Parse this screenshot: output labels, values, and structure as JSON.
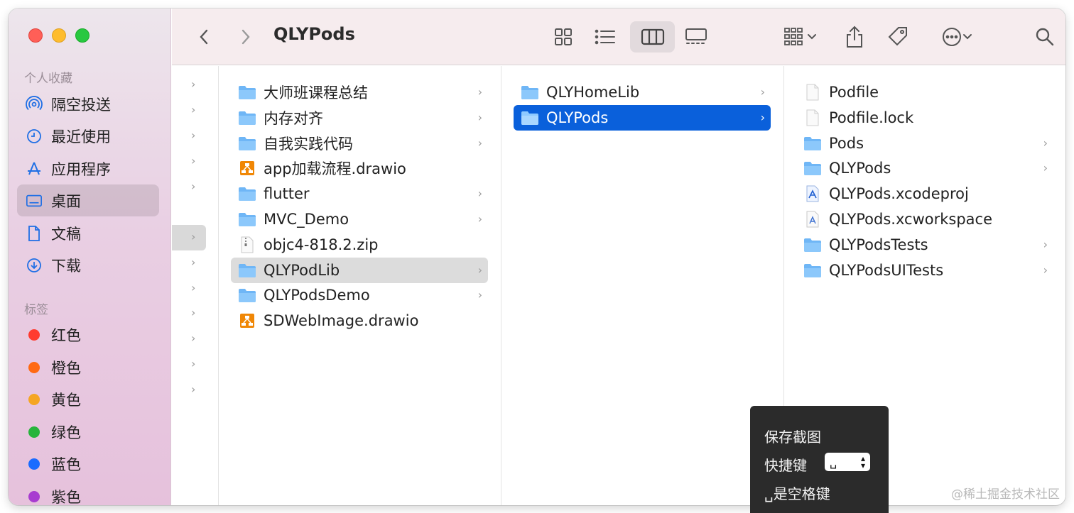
{
  "window": {
    "title": "QLYPods"
  },
  "sidebar": {
    "favorites_title": "个人收藏",
    "favorites": [
      {
        "label": "隔空投送",
        "icon": "airdrop-icon"
      },
      {
        "label": "最近使用",
        "icon": "clock-icon"
      },
      {
        "label": "应用程序",
        "icon": "applications-icon"
      },
      {
        "label": "桌面",
        "icon": "desktop-icon",
        "selected": true
      },
      {
        "label": "文稿",
        "icon": "document-icon"
      },
      {
        "label": "下载",
        "icon": "download-icon"
      }
    ],
    "tags_title": "标签",
    "tags": [
      {
        "label": "红色",
        "color": "#ff3b30"
      },
      {
        "label": "橙色",
        "color": "#ff6a13"
      },
      {
        "label": "黄色",
        "color": "#f5a623"
      },
      {
        "label": "绿色",
        "color": "#28b43c"
      },
      {
        "label": "蓝色",
        "color": "#1a6cff"
      },
      {
        "label": "紫色",
        "color": "#a83cd0"
      }
    ]
  },
  "columns": {
    "col2": [
      {
        "name": "大师班课程总结",
        "type": "folder",
        "chevron": true
      },
      {
        "name": "内存对齐",
        "type": "folder",
        "chevron": true
      },
      {
        "name": "自我实践代码",
        "type": "folder",
        "chevron": true
      },
      {
        "name": "app加载流程.drawio",
        "type": "drawio",
        "chevron": false
      },
      {
        "name": "flutter",
        "type": "folder",
        "chevron": true
      },
      {
        "name": "MVC_Demo",
        "type": "folder",
        "chevron": true
      },
      {
        "name": "objc4-818.2.zip",
        "type": "zip",
        "chevron": false
      },
      {
        "name": "QLYPodLib",
        "type": "folder",
        "chevron": true,
        "selected": "gray"
      },
      {
        "name": "QLYPodsDemo",
        "type": "folder",
        "chevron": true
      },
      {
        "name": "SDWebImage.drawio",
        "type": "drawio",
        "chevron": false
      }
    ],
    "col3": [
      {
        "name": "QLYHomeLib",
        "type": "folder",
        "chevron": true
      },
      {
        "name": "QLYPods",
        "type": "folder",
        "chevron": true,
        "selected": "blue"
      }
    ],
    "col4": [
      {
        "name": "Podfile",
        "type": "file",
        "chevron": false
      },
      {
        "name": "Podfile.lock",
        "type": "file",
        "chevron": false
      },
      {
        "name": "Pods",
        "type": "folder",
        "chevron": true
      },
      {
        "name": "QLYPods",
        "type": "folder",
        "chevron": true
      },
      {
        "name": "QLYPods.xcodeproj",
        "type": "xcodeproj",
        "chevron": false
      },
      {
        "name": "QLYPods.xcworkspace",
        "type": "xcworkspace",
        "chevron": false
      },
      {
        "name": "QLYPodsTests",
        "type": "folder",
        "chevron": true
      },
      {
        "name": "QLYPodsUITests",
        "type": "folder",
        "chevron": true
      }
    ]
  },
  "popup": {
    "save": "保存截图",
    "shortcut_label": "快捷键",
    "shortcut_value": "␣",
    "hint": "␣是空格键"
  },
  "watermark": "@稀土掘金技术社区"
}
